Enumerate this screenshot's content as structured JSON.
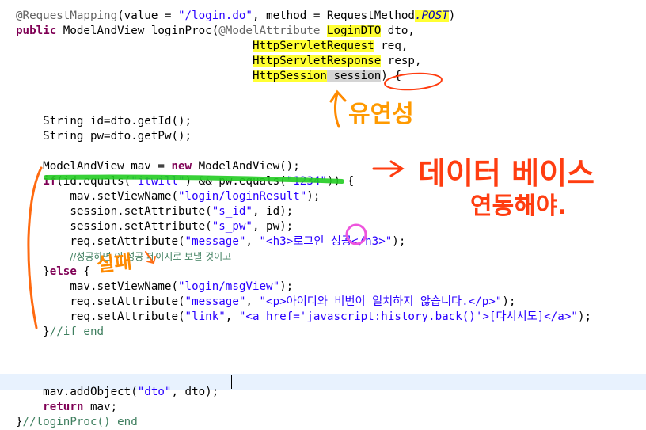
{
  "code_lines": [
    {
      "id": "l1",
      "segs": [
        {
          "t": "@RequestMapping",
          "c": "an"
        },
        {
          "t": "(value = "
        },
        {
          "t": "\"/login.do\"",
          "c": "st"
        },
        {
          "t": ", method = RequestMethod"
        },
        {
          "t": ".POST",
          "c": "pr it hl"
        },
        {
          "t": ")"
        }
      ]
    },
    {
      "id": "l2",
      "segs": [
        {
          "t": "public",
          "c": "kw"
        },
        {
          "t": " ModelAndView loginProc("
        },
        {
          "t": "@ModelAttribute",
          "c": "an"
        },
        {
          "t": " "
        },
        {
          "t": "LoginDTO",
          "c": "hl"
        },
        {
          "t": " dto,"
        }
      ]
    },
    {
      "id": "l3",
      "segs": [
        {
          "t": "                                   "
        },
        {
          "t": "HttpServletRequest",
          "c": "hl"
        },
        {
          "t": " req,"
        }
      ]
    },
    {
      "id": "l4",
      "segs": [
        {
          "t": "                                   "
        },
        {
          "t": "HttpServletResponse",
          "c": "hl"
        },
        {
          "t": " resp,"
        }
      ]
    },
    {
      "id": "l5",
      "segs": [
        {
          "t": "                                   "
        },
        {
          "t": "HttpSession",
          "c": "hl"
        },
        {
          "t": " session",
          "c": "hlgray"
        },
        {
          "t": ") {"
        }
      ]
    },
    {
      "id": "l6",
      "segs": []
    },
    {
      "id": "l7",
      "segs": []
    },
    {
      "id": "l8",
      "segs": [
        {
          "t": "    String id=dto.getId();"
        }
      ]
    },
    {
      "id": "l9",
      "segs": [
        {
          "t": "    String pw=dto.getPw();"
        }
      ]
    },
    {
      "id": "l10",
      "segs": []
    },
    {
      "id": "l11",
      "segs": [
        {
          "t": "    ModelAndView mav = "
        },
        {
          "t": "new",
          "c": "kw"
        },
        {
          "t": " ModelAndView();"
        }
      ]
    },
    {
      "id": "l12",
      "segs": [
        {
          "t": "    "
        },
        {
          "t": "if",
          "c": "kw"
        },
        {
          "t": "(id.equals("
        },
        {
          "t": "\"itwill\"",
          "c": "st"
        },
        {
          "t": ") && pw.equals("
        },
        {
          "t": "\"1234\"",
          "c": "st"
        },
        {
          "t": ")) {"
        }
      ]
    },
    {
      "id": "l13",
      "segs": [
        {
          "t": "        mav.setViewName("
        },
        {
          "t": "\"login/loginResult\"",
          "c": "st"
        },
        {
          "t": ");"
        }
      ]
    },
    {
      "id": "l14",
      "segs": [
        {
          "t": "        session.setAttribute("
        },
        {
          "t": "\"s_id\"",
          "c": "st"
        },
        {
          "t": ", id);"
        }
      ]
    },
    {
      "id": "l15",
      "segs": [
        {
          "t": "        session.setAttribute("
        },
        {
          "t": "\"s_pw\"",
          "c": "st"
        },
        {
          "t": ", pw);"
        }
      ]
    },
    {
      "id": "l16",
      "segs": [
        {
          "t": "        req.setAttribute("
        },
        {
          "t": "\"message\"",
          "c": "st"
        },
        {
          "t": ", "
        },
        {
          "t": "\"<h3>로그인 성공</h3>\"",
          "c": "st"
        },
        {
          "t": ");"
        }
      ]
    },
    {
      "id": "l17",
      "segs": [
        {
          "t": "        "
        },
        {
          "t": "//성공하면 이 성공 페이지로 보낼 것이고",
          "c": "cm2"
        }
      ]
    },
    {
      "id": "l18",
      "segs": [
        {
          "t": "    }"
        },
        {
          "t": "else",
          "c": "kw"
        },
        {
          "t": " {"
        }
      ]
    },
    {
      "id": "l19",
      "segs": [
        {
          "t": "        mav.setViewName("
        },
        {
          "t": "\"login/msgView\"",
          "c": "st"
        },
        {
          "t": ");"
        }
      ]
    },
    {
      "id": "l20",
      "segs": [
        {
          "t": "        req.setAttribute("
        },
        {
          "t": "\"message\"",
          "c": "st"
        },
        {
          "t": ", "
        },
        {
          "t": "\"<p>아이디와 비번이 일치하지 않습니다.</p>\"",
          "c": "st"
        },
        {
          "t": ");"
        }
      ]
    },
    {
      "id": "l21",
      "segs": [
        {
          "t": "        req.setAttribute("
        },
        {
          "t": "\"link\"",
          "c": "st"
        },
        {
          "t": ", "
        },
        {
          "t": "\"<a href='javascript:history.back()'>[다시시도]</a>\"",
          "c": "st"
        },
        {
          "t": ");"
        }
      ]
    },
    {
      "id": "l22",
      "segs": [
        {
          "t": "    }"
        },
        {
          "t": "//if end",
          "c": "cm"
        }
      ]
    },
    {
      "id": "l23",
      "segs": []
    },
    {
      "id": "l24",
      "segs": []
    },
    {
      "id": "l25",
      "segs": []
    },
    {
      "id": "l26",
      "segs": [
        {
          "t": "    mav.addObject("
        },
        {
          "t": "\"dto\"",
          "c": "st"
        },
        {
          "t": ", dto);"
        }
      ]
    },
    {
      "id": "l27",
      "segs": [
        {
          "t": "    "
        },
        {
          "t": "return",
          "c": "kw"
        },
        {
          "t": " mav;"
        }
      ]
    },
    {
      "id": "l28",
      "segs": [
        {
          "t": "}"
        },
        {
          "t": "//loginProc() end",
          "c": "cm"
        }
      ]
    }
  ],
  "annotations": {
    "flexibility_note": "유연성",
    "database_note_line1": "데이터 베이스",
    "database_note_line2": "연동해야.",
    "failure_note": "실패"
  },
  "colors": {
    "annotation_orange": "#ff6a10",
    "annotation_green": "#22cc22",
    "annotation_magenta": "#ee55dd",
    "highlight_yellow": "#ffff33",
    "current_line": "#e8f2fe"
  }
}
